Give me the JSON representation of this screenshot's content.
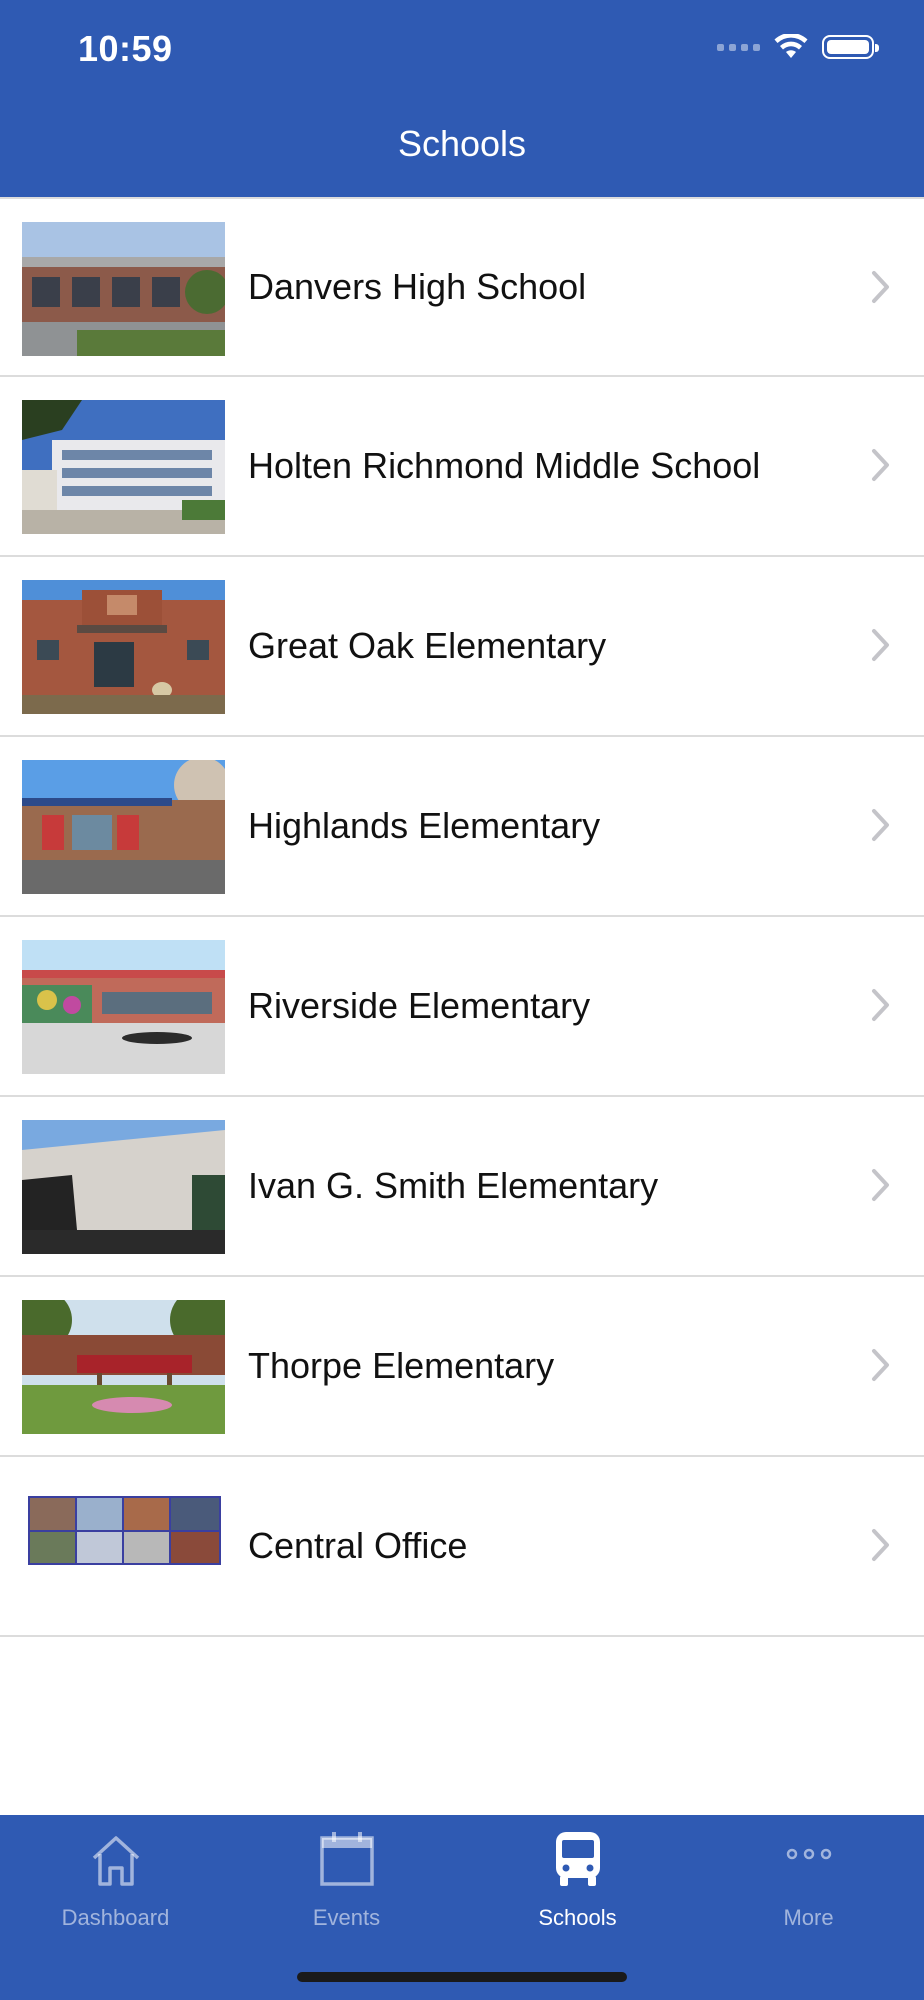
{
  "status_bar": {
    "time": "10:59"
  },
  "header": {
    "title": "Schools"
  },
  "schools": [
    {
      "name": "Danvers High School",
      "thumb_icon": "danvers-high-photo"
    },
    {
      "name": "Holten Richmond Middle School",
      "thumb_icon": "holten-richmond-photo"
    },
    {
      "name": "Great Oak Elementary",
      "thumb_icon": "great-oak-photo"
    },
    {
      "name": "Highlands Elementary",
      "thumb_icon": "highlands-photo"
    },
    {
      "name": "Riverside Elementary",
      "thumb_icon": "riverside-photo"
    },
    {
      "name": "Ivan G. Smith Elementary",
      "thumb_icon": "ivan-smith-photo"
    },
    {
      "name": "Thorpe Elementary",
      "thumb_icon": "thorpe-photo"
    },
    {
      "name": "Central Office",
      "thumb_icon": "central-office-photo"
    }
  ],
  "tabbar": {
    "active": "Schools",
    "tabs": [
      {
        "label": "Dashboard",
        "icon": "house-icon"
      },
      {
        "label": "Events",
        "icon": "calendar-icon"
      },
      {
        "label": "Schools",
        "icon": "bus-icon"
      },
      {
        "label": "More",
        "icon": "ellipsis-icon"
      }
    ]
  },
  "colors": {
    "primary": "#2f5ab3",
    "separator": "#dcdcdc",
    "chevron": "#c4c4c9"
  }
}
